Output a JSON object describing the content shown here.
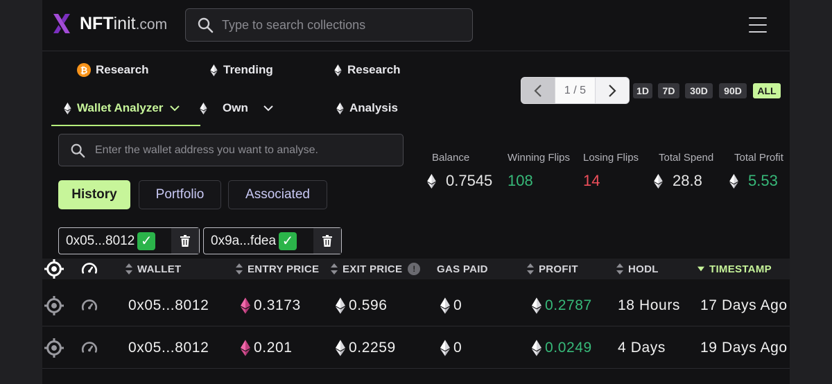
{
  "header": {
    "logo_bold": "NFT",
    "logo_thin": "init",
    "logo_domain": ".com",
    "search_placeholder": "Type to search collections"
  },
  "nav": [
    {
      "label": "Research",
      "icon": "bitcoin-icon"
    },
    {
      "label": "Trending",
      "icon": "ethereum-icon"
    },
    {
      "label": "Research",
      "icon": "ethereum-icon"
    },
    {
      "label": "Wallet Analyzer",
      "icon": "ethereum-icon",
      "active": true
    },
    {
      "label": "Own",
      "icon": "ethereum-icon"
    },
    {
      "label": "Analysis",
      "icon": "ethereum-icon"
    }
  ],
  "wallet_search_placeholder": "Enter the wallet address you want to analyse.",
  "view_tabs": [
    "History",
    "Portfolio",
    "Associated"
  ],
  "active_view": "History",
  "wallet_chips": [
    "0x05...8012",
    "0x9a...fdea"
  ],
  "pager": {
    "label": "1 / 5"
  },
  "ranges": [
    "1D",
    "7D",
    "30D",
    "90D",
    "ALL"
  ],
  "active_range": "ALL",
  "stats": {
    "balance_label": "Balance",
    "balance": "0.7545",
    "winning_label": "Winning Flips",
    "winning": "108",
    "losing_label": "Losing Flips",
    "losing": "14",
    "spend_label": "Total Spend",
    "spend": "28.8",
    "profit_label": "Total Profit",
    "profit": "5.53"
  },
  "table": {
    "columns": [
      "WALLET",
      "ENTRY PRICE",
      "EXIT PRICE",
      "GAS PAID",
      "PROFIT",
      "HODL",
      "TIMESTAMP"
    ],
    "rows": [
      {
        "wallet": "0x05...8012",
        "entry": "0.3173",
        "exit": "0.596",
        "gas": "0",
        "profit": "0.2787",
        "hodl": "18 Hours",
        "timestamp": "17 Days Ago"
      },
      {
        "wallet": "0x05...8012",
        "entry": "0.201",
        "exit": "0.2259",
        "gas": "0",
        "profit": "0.0249",
        "hodl": "4 Days",
        "timestamp": "19 Days Ago"
      }
    ]
  },
  "colors": {
    "accent": "#c7f59a",
    "positive": "#37b979",
    "negative": "#ef4f5b",
    "polygon": "#e0539a"
  }
}
